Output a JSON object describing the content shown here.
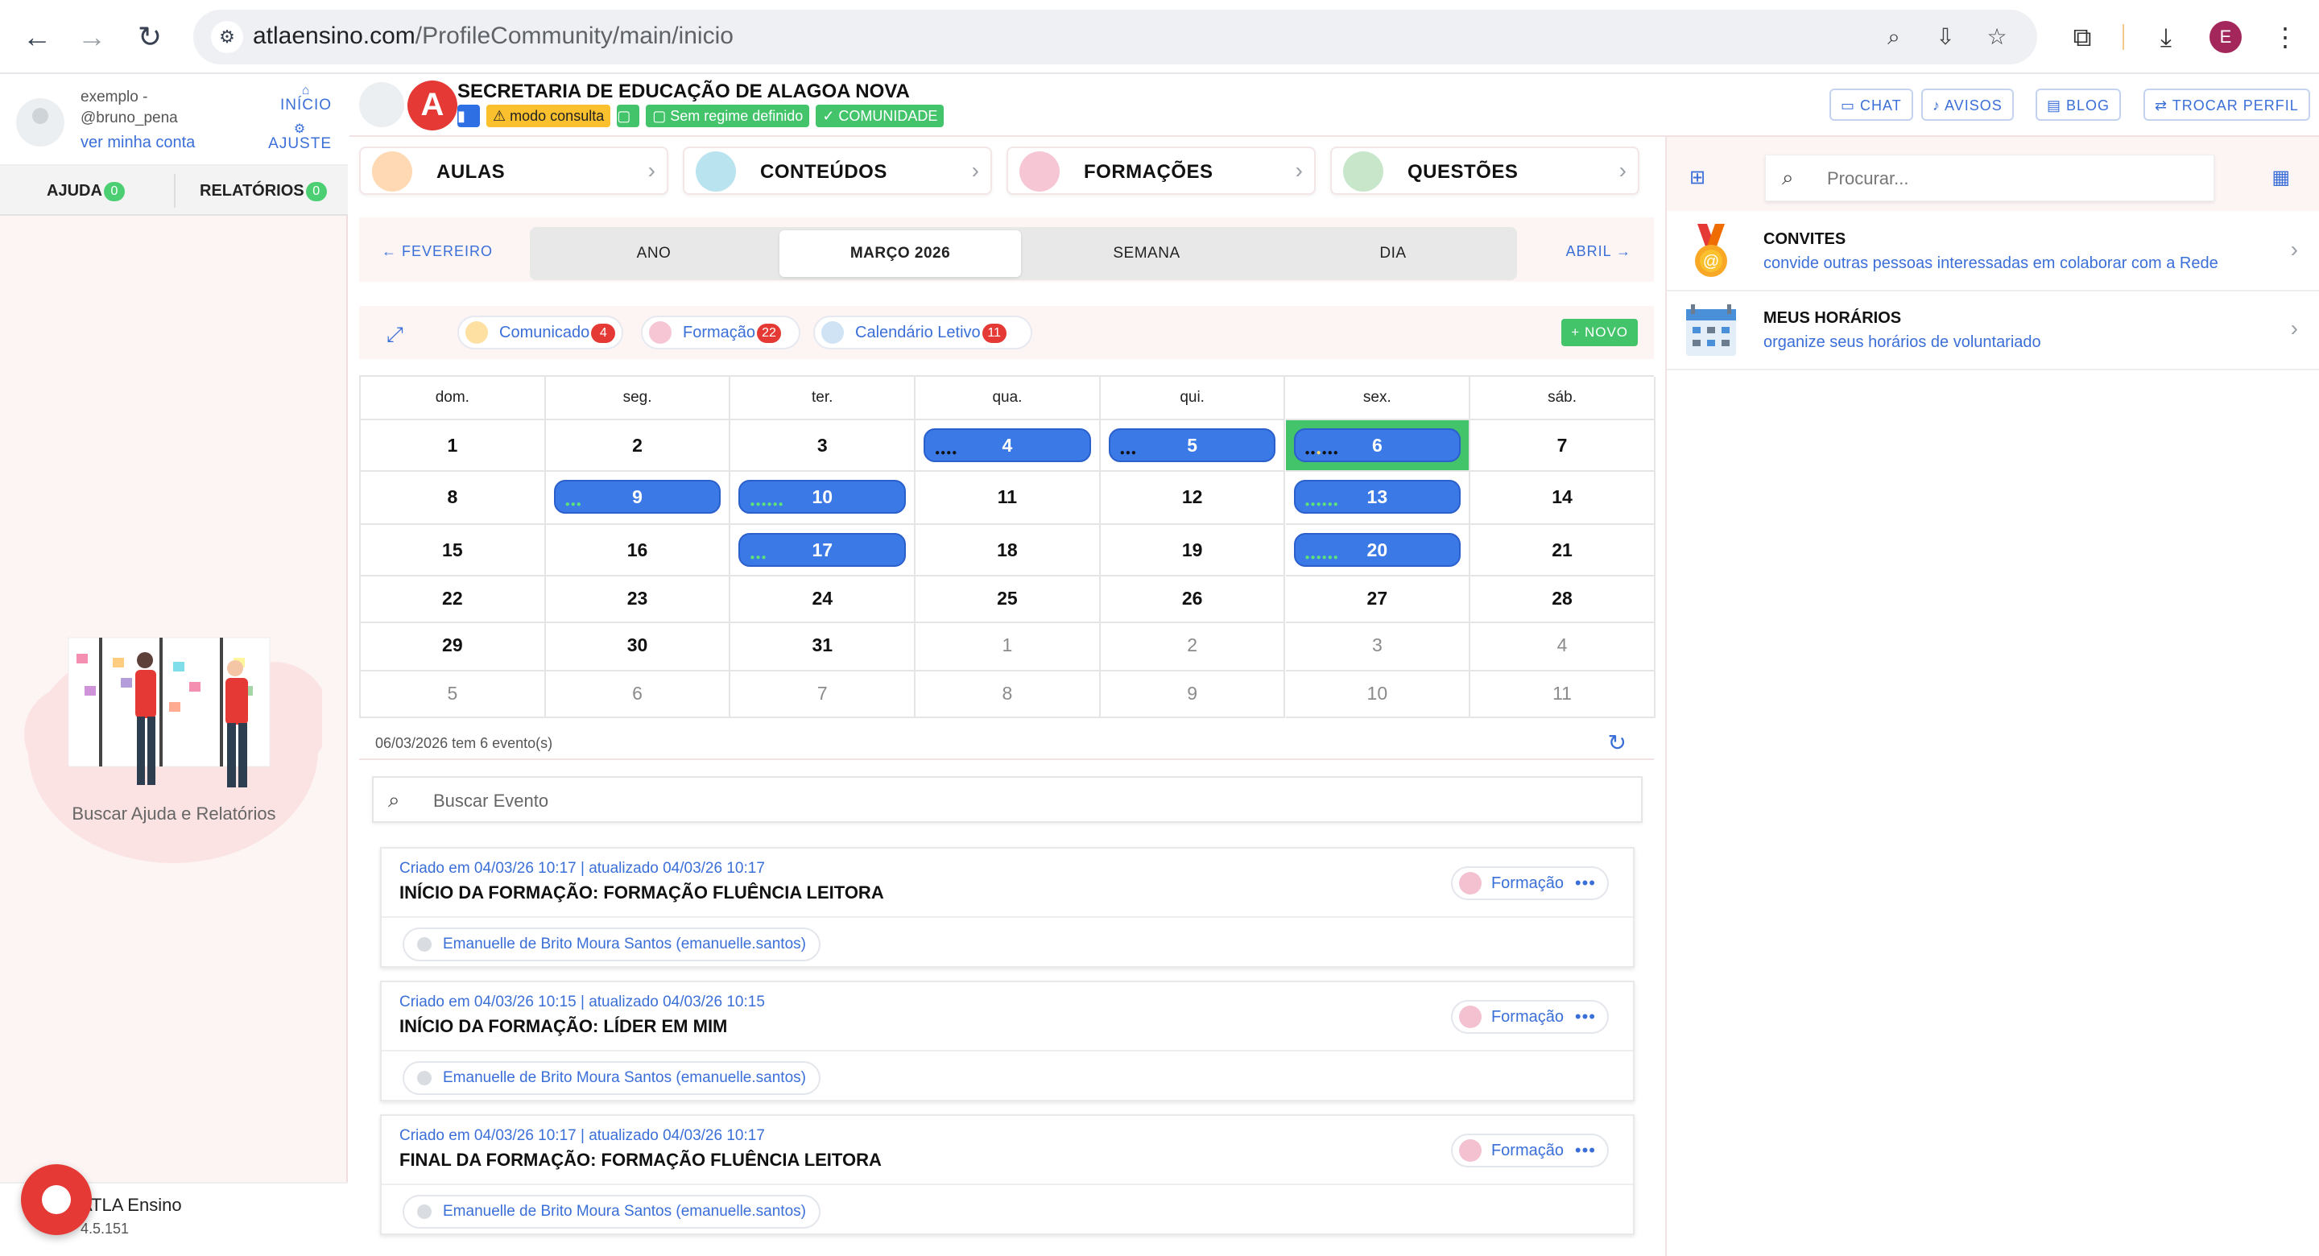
{
  "browser": {
    "url_domain": "atlaensino.com",
    "url_path": "/ProfileCommunity/main/inicio",
    "profile_initial": "E"
  },
  "sidebar": {
    "user_line1": "exemplo -",
    "user_line2": "@bruno_pena",
    "my_account_link": "ver minha conta",
    "inicio": "INÍCIO",
    "ajuste": "AJUSTE",
    "tabs": [
      {
        "label": "AJUDA",
        "count": "0"
      },
      {
        "label": "RELATÓRIOS",
        "count": "0"
      }
    ],
    "help_caption": "Buscar Ajuda e Relatórios",
    "app_name": "ATLA Ensino",
    "version": "4.5.151"
  },
  "header": {
    "org_title": "SECRETARIA DE EDUCAÇÃO DE ALAGOA NOVA",
    "tag_mode": "modo consulta",
    "tag_regime": "Sem regime definido",
    "tag_community": "COMUNIDADE",
    "buttons": [
      "CHAT",
      "AVISOS",
      "BLOG",
      "TROCAR PERFIL"
    ]
  },
  "categories": [
    "AULAS",
    "CONTEÚDOS",
    "FORMAÇÕES",
    "QUESTÕES"
  ],
  "calendar_nav": {
    "prev": "FEVEREIRO",
    "next": "ABRIL",
    "views": [
      "ANO",
      "MARÇO 2026",
      "SEMANA",
      "DIA"
    ],
    "active_view": "MARÇO 2026"
  },
  "filters": {
    "chips": [
      {
        "label": "Comunicado",
        "count": "4"
      },
      {
        "label": "Formação",
        "count": "22"
      },
      {
        "label": "Calendário Letivo",
        "count": "11"
      }
    ],
    "new_button": "NOVO"
  },
  "calendar": {
    "weekdays": [
      "dom.",
      "seg.",
      "ter.",
      "qua.",
      "qui.",
      "sex.",
      "sáb."
    ],
    "weeks": [
      [
        {
          "d": "1"
        },
        {
          "d": "2"
        },
        {
          "d": "3"
        },
        {
          "d": "4",
          "ev": "dark4"
        },
        {
          "d": "5",
          "ev": "dark3"
        },
        {
          "d": "6",
          "ev": "mixed",
          "today": true
        },
        {
          "d": "7"
        }
      ],
      [
        {
          "d": "8"
        },
        {
          "d": "9",
          "ev": "green3"
        },
        {
          "d": "10",
          "ev": "green6"
        },
        {
          "d": "11"
        },
        {
          "d": "12"
        },
        {
          "d": "13",
          "ev": "green6"
        },
        {
          "d": "14"
        }
      ],
      [
        {
          "d": "15"
        },
        {
          "d": "16"
        },
        {
          "d": "17",
          "ev": "green3"
        },
        {
          "d": "18"
        },
        {
          "d": "19"
        },
        {
          "d": "20",
          "ev": "green6"
        },
        {
          "d": "21"
        }
      ],
      [
        {
          "d": "22"
        },
        {
          "d": "23"
        },
        {
          "d": "24"
        },
        {
          "d": "25"
        },
        {
          "d": "26"
        },
        {
          "d": "27"
        },
        {
          "d": "28"
        }
      ],
      [
        {
          "d": "29"
        },
        {
          "d": "30"
        },
        {
          "d": "31"
        },
        {
          "d": "1",
          "m": true
        },
        {
          "d": "2",
          "m": true
        },
        {
          "d": "3",
          "m": true
        },
        {
          "d": "4",
          "m": true
        }
      ],
      [
        {
          "d": "5",
          "m": true
        },
        {
          "d": "6",
          "m": true
        },
        {
          "d": "7",
          "m": true
        },
        {
          "d": "8",
          "m": true
        },
        {
          "d": "9",
          "m": true
        },
        {
          "d": "10",
          "m": true
        },
        {
          "d": "11",
          "m": true
        }
      ]
    ],
    "status": "06/03/2026 tem 6 evento(s)"
  },
  "event_search_placeholder": "Buscar Evento",
  "events": [
    {
      "meta": "Criado em 04/03/26 10:17 | atualizado 04/03/26 10:17",
      "title": "INÍCIO DA FORMAÇÃO: FORMAÇÃO FLUÊNCIA LEITORA",
      "type": "Formação",
      "author": "Emanuelle de Brito Moura Santos (emanuelle.santos)"
    },
    {
      "meta": "Criado em 04/03/26 10:15 | atualizado 04/03/26 10:15",
      "title": "INÍCIO DA FORMAÇÃO: LÍDER EM MIM",
      "type": "Formação",
      "author": "Emanuelle de Brito Moura Santos (emanuelle.santos)"
    },
    {
      "meta": "Criado em 04/03/26 10:17 | atualizado 04/03/26 10:17",
      "title": "FINAL DA FORMAÇÃO: FORMAÇÃO FLUÊNCIA LEITORA",
      "type": "Formação",
      "author": "Emanuelle de Brito Moura Santos (emanuelle.santos)"
    }
  ],
  "right_panel": {
    "search_placeholder": "Procurar...",
    "items": [
      {
        "title": "CONVITES",
        "subtitle": "convide outras pessoas interessadas em colaborar com a Rede",
        "icon": "medal-icon"
      },
      {
        "title": "MEUS HORÁRIOS",
        "subtitle": "organize seus horários de voluntariado",
        "icon": "calendar-icon"
      }
    ]
  }
}
